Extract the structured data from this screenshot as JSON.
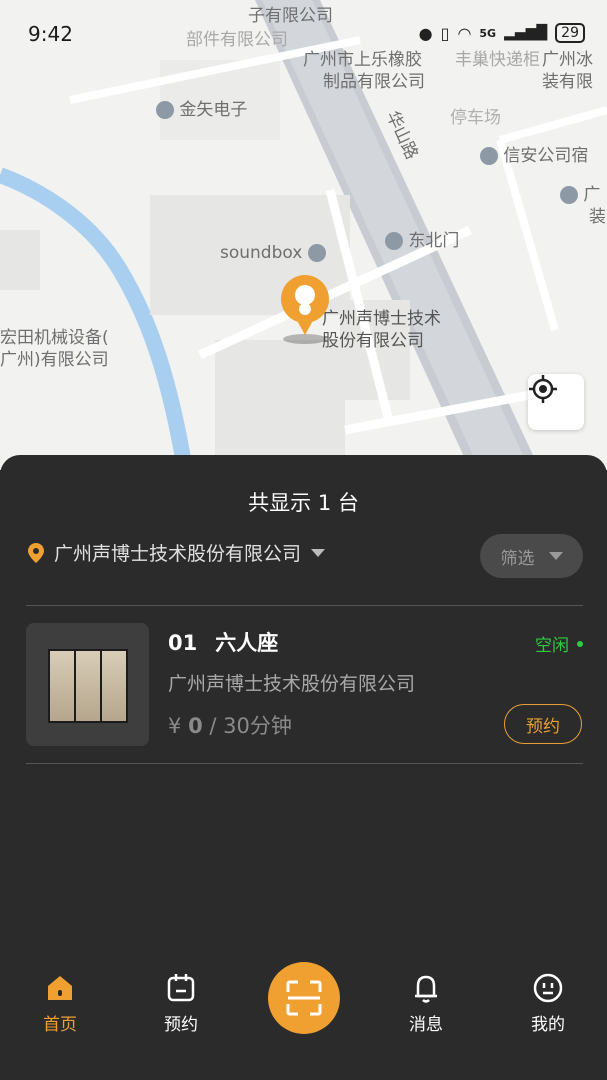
{
  "status_bar": {
    "time": "9:42",
    "network": "5G",
    "battery": "29"
  },
  "map": {
    "pois": [
      "子有限公司",
      "部件有限公司",
      "广州市上乐橡胶",
      "制品有限公司",
      "丰巢快递柜",
      "广州冰",
      "装有限",
      "金矢电子",
      "华山路",
      "停车场",
      "信安公司宿",
      "广",
      "装",
      "soundbox",
      "东北门",
      "广州声博士技术",
      "股份有限公司",
      "宏田机械设备(",
      "广州)有限公司"
    ]
  },
  "sheet": {
    "title": "共显示 1 台",
    "location": "广州声博士技术股份有限公司",
    "filter_label": "筛选",
    "items": [
      {
        "number": "01",
        "name": "六人座",
        "company": "广州声博士技术股份有限公司",
        "price_symbol": "¥",
        "price_value": "0",
        "price_unit": " / 30分钟",
        "status": "空闲",
        "book_label": "预约"
      }
    ]
  },
  "tabbar": {
    "tabs": [
      {
        "label": "首页",
        "icon": "home-icon",
        "active": true
      },
      {
        "label": "预约",
        "icon": "calendar-icon"
      },
      {
        "label": "",
        "icon": "scan-icon"
      },
      {
        "label": "消息",
        "icon": "bell-icon"
      },
      {
        "label": "我的",
        "icon": "profile-icon"
      }
    ]
  },
  "colors": {
    "accent": "#f0a030",
    "free": "#2ecc40",
    "sheet": "#2b2b2b"
  }
}
